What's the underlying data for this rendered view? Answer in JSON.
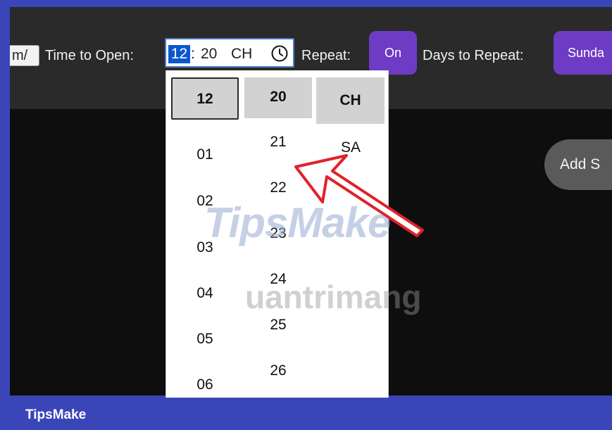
{
  "toolbar": {
    "url_fragment": "m/",
    "time_label": "Time to Open:",
    "time_value": {
      "hour": "12",
      "separator": ":",
      "minute": "20",
      "period": "CH"
    },
    "repeat_label": "Repeat:",
    "repeat_button": "On",
    "days_label": "Days to Repeat:",
    "days_button": "Sunda"
  },
  "main": {
    "add_button": "Add S"
  },
  "picker": {
    "hour_selected": "12",
    "minute_selected": "20",
    "period_selected": "CH",
    "hours": [
      "01",
      "02",
      "03",
      "04",
      "05",
      "06"
    ],
    "minutes": [
      "21",
      "22",
      "23",
      "24",
      "25",
      "26"
    ],
    "periods": [
      "SA"
    ]
  },
  "watermarks": {
    "tipsmake": "TipsMake",
    "quantrimang": "uantrimang"
  },
  "footer": {
    "brand": "TipsMake"
  },
  "colors": {
    "frame_border": "#3a46b8",
    "accent_purple": "#6e3bc4",
    "selection_blue": "#0b57d0",
    "arrow_red": "#e0212a"
  }
}
